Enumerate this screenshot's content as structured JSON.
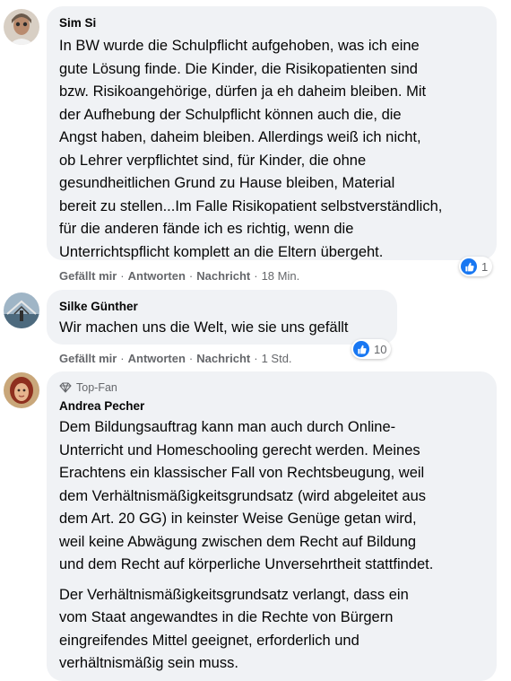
{
  "comments": [
    {
      "author": "Sim Si",
      "text": "In BW wurde die Schulpflicht aufgehoben, was ich eine\ngute Lösung finde. Die Kinder, die Risikopatienten sind\nbzw. Risikoangehörige, dürfen ja eh daheim bleiben. Mit\nder Aufhebung der Schulpflicht können auch die, die\nAngst haben, daheim bleiben. Allerdings weiß ich nicht,\nob Lehrer verpflichtet sind, für Kinder, die ohne\ngesundheitlichen Grund zu Hause bleiben, Material\nbereit zu stellen...Im Falle Risikopatient selbstverständlich,\nfür die anderen fände ich es richtig, wenn die\nUnterrichtspflicht komplett an die Eltern übergeht.",
      "like_label": "Gefällt mir",
      "reply_label": "Antworten",
      "message_label": "Nachricht",
      "time": "18 Min.",
      "reaction_count": "1"
    },
    {
      "author": "Silke Günther",
      "text": "Wir machen uns die Welt, wie sie uns gefällt",
      "like_label": "Gefällt mir",
      "reply_label": "Antworten",
      "message_label": "Nachricht",
      "time": "1 Std.",
      "reaction_count": "10"
    },
    {
      "badge": "Top-Fan",
      "author": "Andrea Pecher",
      "text": "Dem Bildungsauftrag kann man auch durch Online-\nUnterricht und Homeschooling gerecht werden. Meines\nErachtens ein klassischer Fall von Rechtsbeugung, weil\ndem Verhältnismäßigkeitsgrundsatz (wird abgeleitet aus\ndem Art. 20 GG) in keinster Weise Genüge getan wird,\nweil keine Abwägung zwischen dem Recht auf Bildung\nund dem Recht auf körperliche Unversehrtheit stattfindet.",
      "text2": "Der Verhältnismäßigkeitsgrundsatz verlangt, dass ein\nvom Staat angewandtes in die Rechte von Bürgern\neingreifendes Mittel geeignet, erforderlich und\nverhältnismäßig sein muss."
    }
  ],
  "colors": {
    "bubble": "#f0f2f5",
    "like_blue": "#1877f2",
    "meta_gray": "#65676b"
  }
}
